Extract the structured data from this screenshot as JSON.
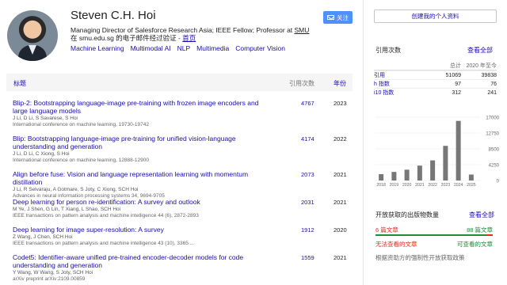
{
  "profile": {
    "name": "Steven C.H. Hoi",
    "affiliation_prefix": "Managing Director of Salesforce Research Asia; IEEE Fellow; Professor at ",
    "affiliation_link": "SMU",
    "verified_prefix": "在 smu.edu.sg 的电子邮件经过验证 - ",
    "homepage": "首页",
    "interests": [
      "Machine Learning",
      "Multimodal AI",
      "NLP",
      "Multimedia",
      "Computer Vision"
    ],
    "follow": "关注"
  },
  "table": {
    "col_title": "标题",
    "col_cited": "引用次数",
    "col_year": "年份"
  },
  "articles": [
    {
      "title": "Blip-2: Bootstrapping language-image pre-training with frozen image encoders and large language models",
      "authors": "J Li, D Li, S Savarese, S Hoi",
      "venue": "International conference on machine learning, 19730-19742",
      "cited": "4767",
      "year": "2023"
    },
    {
      "title": "Blip: Bootstrapping language-image pre-training for unified vision-language understanding and generation",
      "authors": "J Li, D Li, C Xiong, S Hoi",
      "venue": "International conference on machine learning, 12888-12900",
      "cited": "4174",
      "year": "2022"
    },
    {
      "title": "Align before fuse: Vision and language representation learning with momentum distillation",
      "authors": "J Li, R Selvaraju, A Gotmare, S Joty, C Xiong, SCH Hoi",
      "venue": "Advances in neural information processing systems 34, 9694-9705",
      "cited": "2073",
      "year": "2021"
    },
    {
      "title": "Deep learning for person re-identification: A survey and outlook",
      "authors": "M Ye, J Shen, G Lin, T Xiang, L Shao, SCH Hoi",
      "venue": "IEEE transactions on pattern analysis and machine intelligence 44 (6), 2872-2893",
      "cited": "2031",
      "year": "2021"
    },
    {
      "title": "Deep learning for image super-resolution: A survey",
      "authors": "Z Wang, J Chen, SCH Hoi",
      "venue": "IEEE transactions on pattern analysis and machine intelligence 43 (10), 3365 ...",
      "cited": "1912",
      "year": "2020"
    },
    {
      "title": "Codet5: Identifier-aware unified pre-trained encoder-decoder models for code understanding and generation",
      "authors": "Y Wang, W Wang, S Joty, SCH Hoi",
      "venue": "arXiv preprint arXiv:2109.00859",
      "cited": "1559",
      "year": "2021"
    }
  ],
  "sidebar": {
    "create_profile": "创建我的个人资料",
    "cited_by_title": "引用次数",
    "view_all": "查看全部",
    "stats_header": [
      "",
      "总计",
      "2020 年至今"
    ],
    "stats": [
      [
        "引用",
        "51069",
        "39838"
      ],
      [
        "h 指数",
        "97",
        "76"
      ],
      [
        "i10 指数",
        "312",
        "241"
      ]
    ],
    "oa_title": "开放获取的出版物数量",
    "oa_view_all": "查看全部",
    "oa_unavailable_count": "6 篇文章",
    "oa_available_count": "88 篇文章",
    "oa_unavailable": "无法查看的文章",
    "oa_available": "可查看的文章",
    "oa_note": "根据资助方的强制性开放获取政策",
    "oa_available_fraction": 0.936
  },
  "chart_data": {
    "type": "bar",
    "categories": [
      "2018",
      "2019",
      "2020",
      "2021",
      "2022",
      "2023",
      "2024",
      "2025"
    ],
    "values": [
      1700,
      2300,
      2900,
      4000,
      5400,
      9300,
      16000,
      1600
    ],
    "yticks": [
      "17000",
      "12750",
      "8500",
      "4250",
      "0"
    ],
    "ylim": [
      0,
      17000
    ],
    "color": "#777777"
  }
}
